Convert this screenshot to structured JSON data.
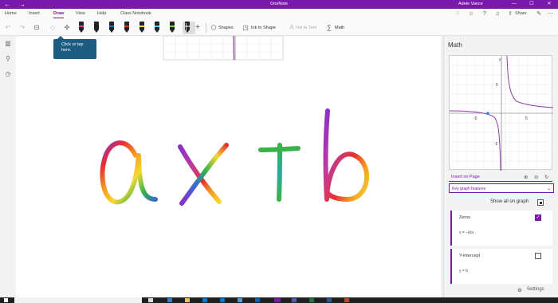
{
  "titlebar": {
    "title": "OneNote",
    "user": "Adele Vance",
    "back_glyph": "←",
    "forward_glyph": "→",
    "minimize_glyph": "—",
    "maximize_glyph": "☐",
    "close_glyph": "✕",
    "color": "#7719aa"
  },
  "ribbon": {
    "tabs": [
      "Home",
      "Insert",
      "Draw",
      "View",
      "Help",
      "Class Notebook"
    ],
    "active_tab": "Draw",
    "share_label": "Share"
  },
  "toolbar": {
    "shapes_label": "Shapes",
    "ink_to_shape_label": "Ink to Shape",
    "ink_to_text_label": "Ink to Text",
    "math_label": "Math",
    "pens": [
      {
        "color": "#e63ba8"
      },
      {
        "color": "#1d1d1d"
      },
      {
        "color": "#1a6bd8"
      },
      {
        "color": "#e8312f"
      },
      {
        "color": "#f1e030"
      },
      {
        "color": "#35d8f0"
      },
      {
        "color": "#7cd44a"
      },
      {
        "color": "#9d9d9d"
      }
    ]
  },
  "tooltip": {
    "text": "Click or tap here."
  },
  "canvas": {
    "ink_expression": "ax+b"
  },
  "math_panel": {
    "title": "Math",
    "insert_label": "Insert on Page",
    "dropdown_label": "Key graph features",
    "show_all_label": "Show all on graph",
    "graph_ticks": {
      "x_neg": "-5",
      "x_pos": "5",
      "y_pos": "5",
      "y_neg": "-5",
      "y_axis": "y"
    },
    "features": [
      {
        "name": "Zeros",
        "value": "x = −b/a",
        "checked": true
      },
      {
        "name": "Y-intercept",
        "value": "y = b",
        "checked": false
      }
    ],
    "settings_label": "Settings"
  }
}
